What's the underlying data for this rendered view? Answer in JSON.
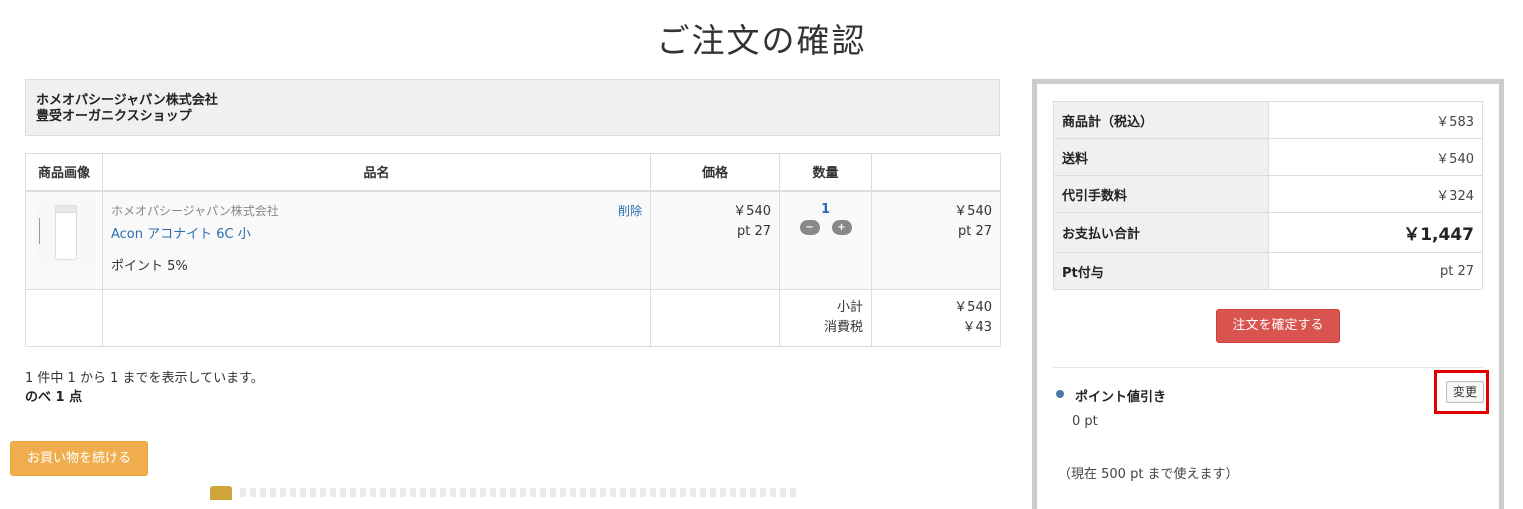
{
  "page_title": "ご注文の確認",
  "shop": {
    "line1": "ホメオパシージャパン株式会社",
    "line2": "豊受オーガニクスショップ"
  },
  "cart": {
    "headers": {
      "image": "商品画像",
      "name": "品名",
      "price": "価格",
      "qty": "数量",
      "subtotal": ""
    },
    "item": {
      "maker": "ホメオパシージャパン株式会社",
      "product": "Acon アコナイト 6C 小",
      "points": "ポイント 5%",
      "delete": "削除",
      "price": "￥540",
      "price_pt": "pt 27",
      "qty": "1",
      "minus": "−",
      "plus": "+",
      "line_total": "￥540",
      "line_pt": "pt 27"
    },
    "subtotal_label": "小計",
    "tax_label": "消費税",
    "subtotal_value": "￥540",
    "tax_value": "￥43"
  },
  "count_text": "1 件中 1 から 1 までを表示しています。",
  "total_units": "のべ 1 点",
  "continue_button": "お買い物を続ける",
  "summary": {
    "rows": [
      {
        "k": "商品計（税込）",
        "v": "￥583"
      },
      {
        "k": "送料",
        "v": "￥540"
      },
      {
        "k": "代引手数料",
        "v": "￥324"
      },
      {
        "k": "お支払い合計",
        "v": "￥1,447"
      },
      {
        "k": "Pt付与",
        "v": "pt 27"
      }
    ],
    "confirm_button": "注文を確定する",
    "point_discount_title": "ポイント値引き",
    "change_button": "変更",
    "point_value": "0 pt",
    "point_available": "（現在 500 pt まで使えます）"
  },
  "colors": {
    "confirm": "#d9534f",
    "continue": "#f0ad4e",
    "link": "#2a6db3",
    "highlight": "#e00000"
  }
}
